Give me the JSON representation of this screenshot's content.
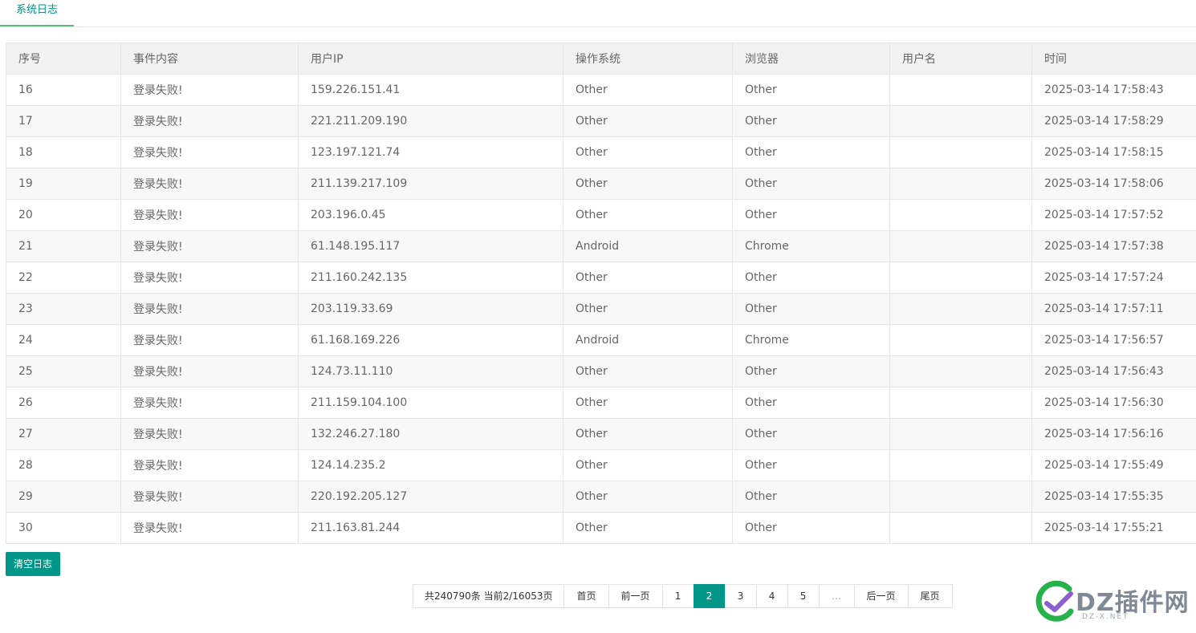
{
  "tab": {
    "label": "系统日志"
  },
  "table": {
    "headers": [
      "序号",
      "事件内容",
      "用户IP",
      "操作系统",
      "浏览器",
      "用户名",
      "时间"
    ],
    "rows": [
      [
        "16",
        "登录失败!",
        "159.226.151.41",
        "Other",
        "Other",
        "",
        "2025-03-14 17:58:43"
      ],
      [
        "17",
        "登录失败!",
        "221.211.209.190",
        "Other",
        "Other",
        "",
        "2025-03-14 17:58:29"
      ],
      [
        "18",
        "登录失败!",
        "123.197.121.74",
        "Other",
        "Other",
        "",
        "2025-03-14 17:58:15"
      ],
      [
        "19",
        "登录失败!",
        "211.139.217.109",
        "Other",
        "Other",
        "",
        "2025-03-14 17:58:06"
      ],
      [
        "20",
        "登录失败!",
        "203.196.0.45",
        "Other",
        "Other",
        "",
        "2025-03-14 17:57:52"
      ],
      [
        "21",
        "登录失败!",
        "61.148.195.117",
        "Android",
        "Chrome",
        "",
        "2025-03-14 17:57:38"
      ],
      [
        "22",
        "登录失败!",
        "211.160.242.135",
        "Other",
        "Other",
        "",
        "2025-03-14 17:57:24"
      ],
      [
        "23",
        "登录失败!",
        "203.119.33.69",
        "Other",
        "Other",
        "",
        "2025-03-14 17:57:11"
      ],
      [
        "24",
        "登录失败!",
        "61.168.169.226",
        "Android",
        "Chrome",
        "",
        "2025-03-14 17:56:57"
      ],
      [
        "25",
        "登录失败!",
        "124.73.11.110",
        "Other",
        "Other",
        "",
        "2025-03-14 17:56:43"
      ],
      [
        "26",
        "登录失败!",
        "211.159.104.100",
        "Other",
        "Other",
        "",
        "2025-03-14 17:56:30"
      ],
      [
        "27",
        "登录失败!",
        "132.246.27.180",
        "Other",
        "Other",
        "",
        "2025-03-14 17:56:16"
      ],
      [
        "28",
        "登录失败!",
        "124.14.235.2",
        "Other",
        "Other",
        "",
        "2025-03-14 17:55:49"
      ],
      [
        "29",
        "登录失败!",
        "220.192.205.127",
        "Other",
        "Other",
        "",
        "2025-03-14 17:55:35"
      ],
      [
        "30",
        "登录失败!",
        "211.163.81.244",
        "Other",
        "Other",
        "",
        "2025-03-14 17:55:21"
      ]
    ]
  },
  "actions": {
    "clear_label": "清空日志"
  },
  "pagination": {
    "summary": "共240790条 当前2/16053页",
    "first": "首页",
    "prev": "前一页",
    "pages": [
      "1",
      "2",
      "3",
      "4",
      "5"
    ],
    "current": "2",
    "ellipsis": "…",
    "next": "后一页",
    "last": "尾页"
  },
  "watermark": {
    "logo_text": "DZ插件网",
    "sub_text": "DZ-X.NET",
    "colors": {
      "green": "#27b24a",
      "purple": "#8e5fd1",
      "gray": "#7f8a96"
    }
  }
}
